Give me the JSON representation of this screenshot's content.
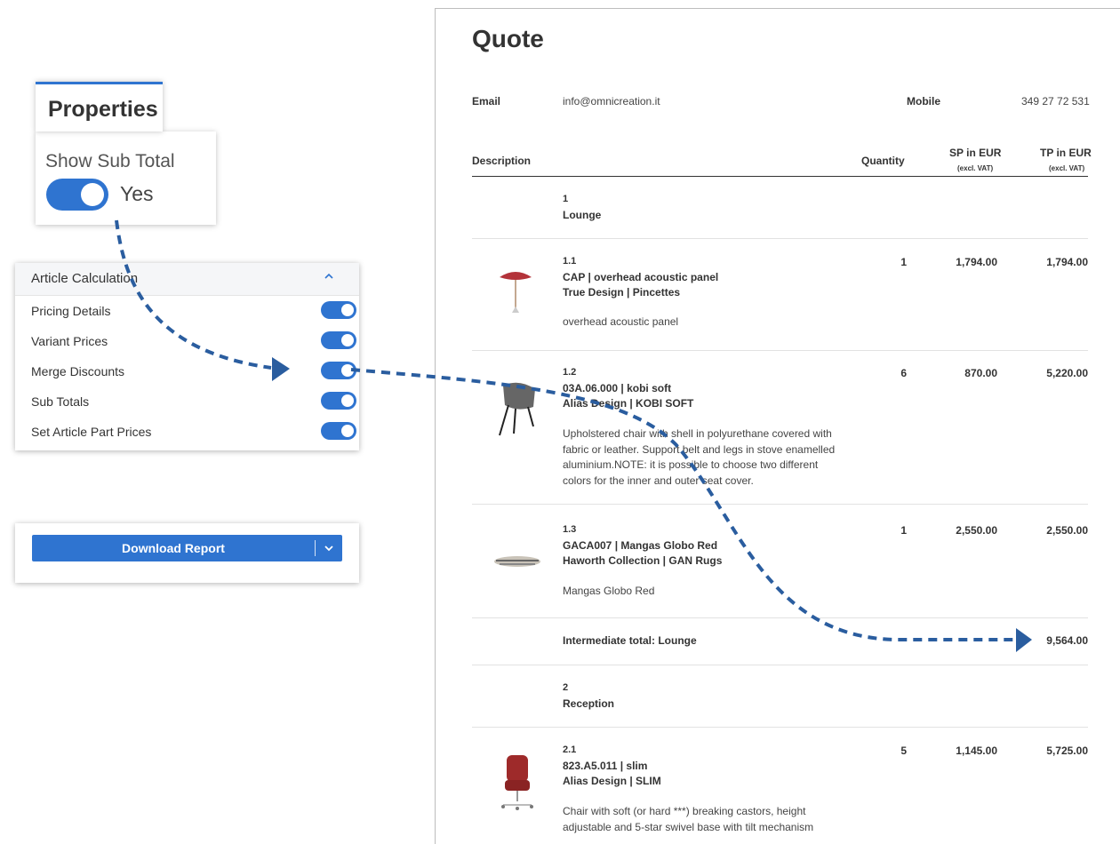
{
  "properties": {
    "tab_title": "Properties",
    "show_sub_total_label": "Show Sub Total",
    "toggle_state": "Yes"
  },
  "article_calculation": {
    "title": "Article Calculation",
    "items": [
      {
        "label": "Pricing Details",
        "on": true
      },
      {
        "label": "Variant Prices",
        "on": true
      },
      {
        "label": "Merge Discounts",
        "on": true
      },
      {
        "label": "Sub Totals",
        "on": true
      },
      {
        "label": "Set Article Part Prices",
        "on": true
      }
    ]
  },
  "download": {
    "label": "Download Report"
  },
  "quote": {
    "title": "Quote",
    "email_label": "Email",
    "email_value": "info@omnicreation.it",
    "mobile_label": "Mobile",
    "mobile_value": "349 27 72 531",
    "columns": {
      "description": "Description",
      "quantity": "Quantity",
      "sp": "SP in EUR",
      "tp": "TP in EUR",
      "sp_sub": "(excl. VAT)",
      "tp_sub": "(excl. VAT)"
    },
    "group1": {
      "number": "1",
      "name": "Lounge"
    },
    "items": [
      {
        "num": "1.1",
        "line1": "CAP | overhead acoustic panel",
        "line2": "True Design | Pincettes",
        "desc": "overhead acoustic panel",
        "qty": "1",
        "sp": "1,794.00",
        "tp": "1,794.00"
      },
      {
        "num": "1.2",
        "line1": "03A.06.000 | kobi soft",
        "line2": "Alias Design | KOBI SOFT",
        "desc": "Upholstered chair with shell in polyurethane covered with fabric or leather. Support belt and legs in stove enamelled aluminium.NOTE: it is possible to choose two different colors for the inner and outer seat cover.",
        "qty": "6",
        "sp": "870.00",
        "tp": "5,220.00"
      },
      {
        "num": "1.3",
        "line1": "GACA007 | Mangas Globo Red",
        "line2": "Haworth Collection | GAN Rugs",
        "desc": "Mangas Globo Red",
        "qty": "1",
        "sp": "2,550.00",
        "tp": "2,550.00"
      }
    ],
    "intermediate_label": "Intermediate total: Lounge",
    "intermediate_value": "9,564.00",
    "group2": {
      "number": "2",
      "name": "Reception"
    },
    "item21": {
      "num": "2.1",
      "line1": "823.A5.011 | slim",
      "line2": "Alias Design | SLIM",
      "desc": "Chair with soft (or hard ***) breaking castors, height adjustable and 5-star swivel base with tilt mechanism",
      "qty": "5",
      "sp": "1,145.00",
      "tp": "5,725.00"
    }
  },
  "colors": {
    "accent": "#2f74d0",
    "arrow": "#2a5d9f"
  },
  "icons": [
    "chevron-up-icon",
    "chevron-down-icon"
  ]
}
